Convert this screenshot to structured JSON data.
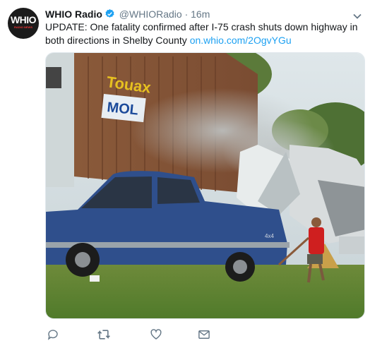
{
  "tweet": {
    "avatar_text": "WHIO",
    "avatar_sub": "RADIO NEWS",
    "display_name": "WHIO Radio",
    "handle": "@WHIORadio",
    "separator": "·",
    "time": "16m",
    "text": "UPDATE: One fatality confirmed after I-75 crash shuts down highway in both directions in Shelby County ",
    "link": "on.whio.com/2OgvYGu",
    "media": {
      "container_brand": "Touax",
      "container_logo": "MOL",
      "truck_badge": "4x4"
    }
  },
  "icons": [
    "verified-badge-icon",
    "caret-down-icon",
    "reply-icon",
    "retweet-icon",
    "like-icon",
    "direct-message-icon"
  ],
  "colors": {
    "link": "#1da1f2",
    "verified": "#1da1f2",
    "muted": "#657786"
  }
}
